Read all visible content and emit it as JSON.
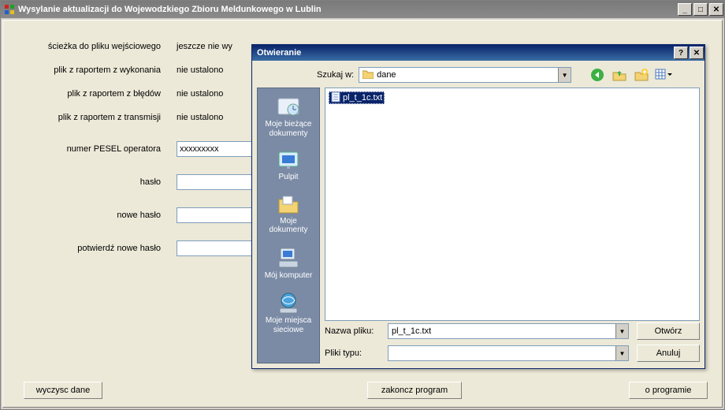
{
  "window": {
    "title": "Wysylanie aktualizacji do Wojewodzkiego Zbioru Meldunkowego w Lublin"
  },
  "form": {
    "labels": {
      "input_path": "ścieżka do pliku wejściowego",
      "exec_report": "plik z raportem z wykonania",
      "error_report": "plik z raportem z błędów",
      "trans_report": "plik z raportem z transmisji",
      "pesel": "numer PESEL operatora",
      "password": "hasło",
      "new_password": "nowe hasło",
      "confirm_password": "potwierdź nowe hasło"
    },
    "status": {
      "input_path": "jeszcze nie wy",
      "exec_report": "nie ustalono",
      "error_report": "nie ustalono",
      "trans_report": "nie ustalono"
    },
    "values": {
      "pesel": "xxxxxxxxx",
      "password": "",
      "new_password": "",
      "confirm_password": ""
    }
  },
  "buttons": {
    "clear": "wyczysc dane",
    "finish": "zakoncz program",
    "about": "o programie"
  },
  "dialog": {
    "title": "Otwieranie",
    "lookin_label": "Szukaj w:",
    "lookin_value": "dane",
    "file_selected": "pl_t_1c.txt",
    "filename_label": "Nazwa pliku:",
    "filename_value": "pl_t_1c.txt",
    "filetype_label": "Pliki typu:",
    "filetype_value": "",
    "open_btn": "Otwórz",
    "cancel_btn": "Anuluj",
    "places": {
      "recent": "Moje bieżące dokumenty",
      "desktop": "Pulpit",
      "mydocs": "Moje dokumenty",
      "mycomputer": "Mój komputer",
      "network": "Moje miejsca sieciowe"
    }
  }
}
